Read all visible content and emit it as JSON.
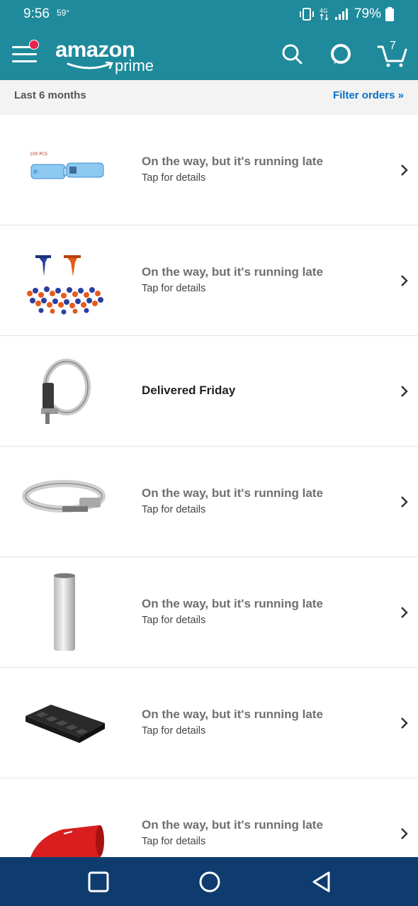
{
  "status_bar": {
    "time": "9:56",
    "temperature": "59°",
    "battery": "79%"
  },
  "header": {
    "logo_word": "amazon",
    "logo_sub": "prime",
    "cart_count": "7"
  },
  "subbar": {
    "range": "Last 6 months",
    "filter": "Filter orders »"
  },
  "orders": [
    {
      "status": "On the way, but it's running late",
      "detail": "Tap for details",
      "image_caption": "100 PCS"
    },
    {
      "status": "On the way, but it's running late",
      "detail": "Tap for details"
    },
    {
      "status": "Delivered Friday"
    },
    {
      "status": "On the way, but it's running late",
      "detail": "Tap for details"
    },
    {
      "status": "On the way, but it's running late",
      "detail": "Tap for details"
    },
    {
      "status": "On the way, but it's running late",
      "detail": "Tap for details"
    },
    {
      "status": "On the way, but it's running late",
      "detail": "Tap for details"
    }
  ],
  "colors": {
    "header": "#1f8a9c",
    "subbar": "#f3f3f3",
    "link": "#0a6fc2",
    "navbar": "#0e3c6e"
  }
}
